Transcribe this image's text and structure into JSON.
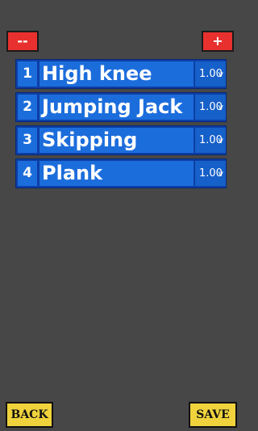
{
  "toolbar": {
    "remove_label": "--",
    "add_label": "+"
  },
  "exercises": [
    {
      "number": "1",
      "name": "High knee",
      "time": "1.00",
      "chevron": "v"
    },
    {
      "number": "2",
      "name": "Jumping Jack",
      "time": "1.00",
      "chevron": "v"
    },
    {
      "number": "3",
      "name": "Skipping",
      "time": "1.00",
      "chevron": "v"
    },
    {
      "number": "4",
      "name": "Plank",
      "time": "1.00",
      "chevron": "v"
    }
  ],
  "footer": {
    "back_label": "BACK",
    "save_label": "SAVE"
  }
}
